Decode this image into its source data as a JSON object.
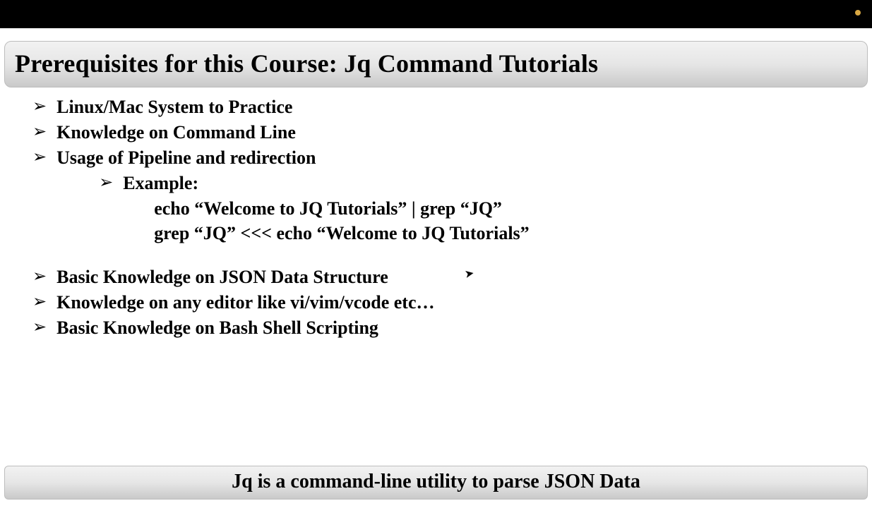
{
  "title": "Prerequisites for this Course: Jq Command Tutorials",
  "bullets_a": [
    "Linux/Mac System to Practice",
    "Knowledge on Command Line",
    "Usage of Pipeline and redirection"
  ],
  "example_label": "Example:",
  "example_lines": [
    "echo “Welcome to JQ Tutorials” | grep “JQ”",
    "grep “JQ” <<< echo “Welcome to JQ Tutorials”"
  ],
  "bullets_b": [
    "Basic Knowledge on JSON Data Structure",
    "Knowledge on any editor like vi/vim/vcode etc…",
    "Basic Knowledge on Bash Shell Scripting"
  ],
  "footer": "Jq is a command-line utility to parse JSON Data"
}
